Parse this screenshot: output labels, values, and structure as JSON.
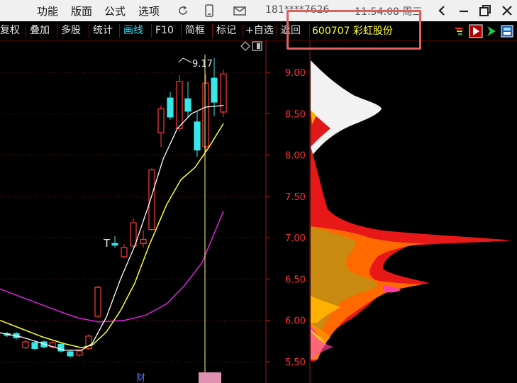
{
  "titlebar": {
    "menus": [
      "功能",
      "版面",
      "公式",
      "选项"
    ],
    "phone": "181****7626",
    "clock": "11:54:08 周三"
  },
  "toolbar": {
    "tabs": [
      "复权",
      "叠加",
      "多股",
      "统计",
      "画线",
      "F10",
      "简框",
      "标记",
      "+自选",
      "返回"
    ],
    "active_tab": "画线"
  },
  "stock": {
    "label": "600707 彩虹股份",
    "code": "600707",
    "name": "彩虹股份"
  },
  "price_axis": {
    "ticks": [
      "9.00",
      "8.50",
      "8.00",
      "7.50",
      "7.00",
      "6.50",
      "6.00",
      "5.50"
    ]
  },
  "annotations": {
    "high_price": "9.17",
    "t_marker": "T",
    "bottom_marker": "财"
  },
  "colors": {
    "up": "#ff3b3b",
    "down": "#38e8e8",
    "ma_white": "#ffffff",
    "ma_yellow": "#ffff30",
    "ma_magenta": "#e020e0",
    "grid": "#7a1010",
    "accent_tab": "#3ce0f0",
    "stock_name": "#ffff33"
  },
  "icons": [
    "refresh-icon",
    "phone-icon",
    "message-icon",
    "back-icon",
    "minimize-icon",
    "restore-icon",
    "close-icon",
    "diamond-icon",
    "layout-icon"
  ]
}
